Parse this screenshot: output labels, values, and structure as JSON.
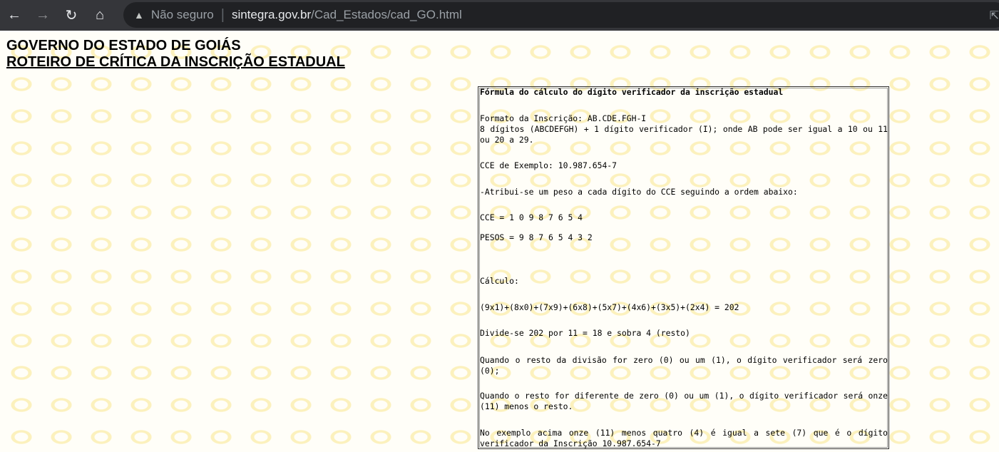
{
  "browser": {
    "back": "←",
    "forward": "→",
    "reload": "↻",
    "home": "⌂",
    "security_label": "Não seguro",
    "url_host": "sintegra.gov.br",
    "url_path": "/Cad_Estados/cad_GO.html"
  },
  "header": {
    "title": "GOVERNO DO ESTADO DE GOIÁS",
    "subtitle": "ROTEIRO DE CRÍTICA DA INSCRIÇÃO ESTADUAL"
  },
  "box": {
    "heading": "Fórmula do cálculo do dígito verificador da inscrição estadual",
    "format": "Formato da Inscrição: AB.CDE.FGH-I",
    "digits": "8 dígitos (ABCDEFGH) + 1 dígito verificador (I); onde AB pode ser igual a 10 ou 11 ou 20 a 29.",
    "example": "CCE de Exemplo: 10.987.654-7",
    "weights_intro": "-Atribui-se um peso a cada dígito do CCE seguindo a ordem abaixo:",
    "cce": "CCE = 1 0 9 8 7 6 5 4",
    "pesos": "PESOS = 9 8 7 6 5 4 3 2",
    "calc_label": "Cálculo:",
    "calc": "(9x1)+(8x0)+(7x9)+(6x8)+(5x7)+(4x6)+(3x5)+(2x4) = 202",
    "divide": "Divide-se 202 por 11 = 18 e sobra 4 (resto)",
    "rule1": "Quando o resto da divisão for zero (0) ou um (1), o dígito verificador será zero (0);",
    "rule2": "Quando o resto for diferente de zero (0) ou um (1), o dígito verificador será onze (11) menos o resto.",
    "conclusion": "No exemplo acima onze (11) menos quatro (4) é igual a sete (7) que é o dígito verificador da Inscrição 10.987.654-7"
  }
}
